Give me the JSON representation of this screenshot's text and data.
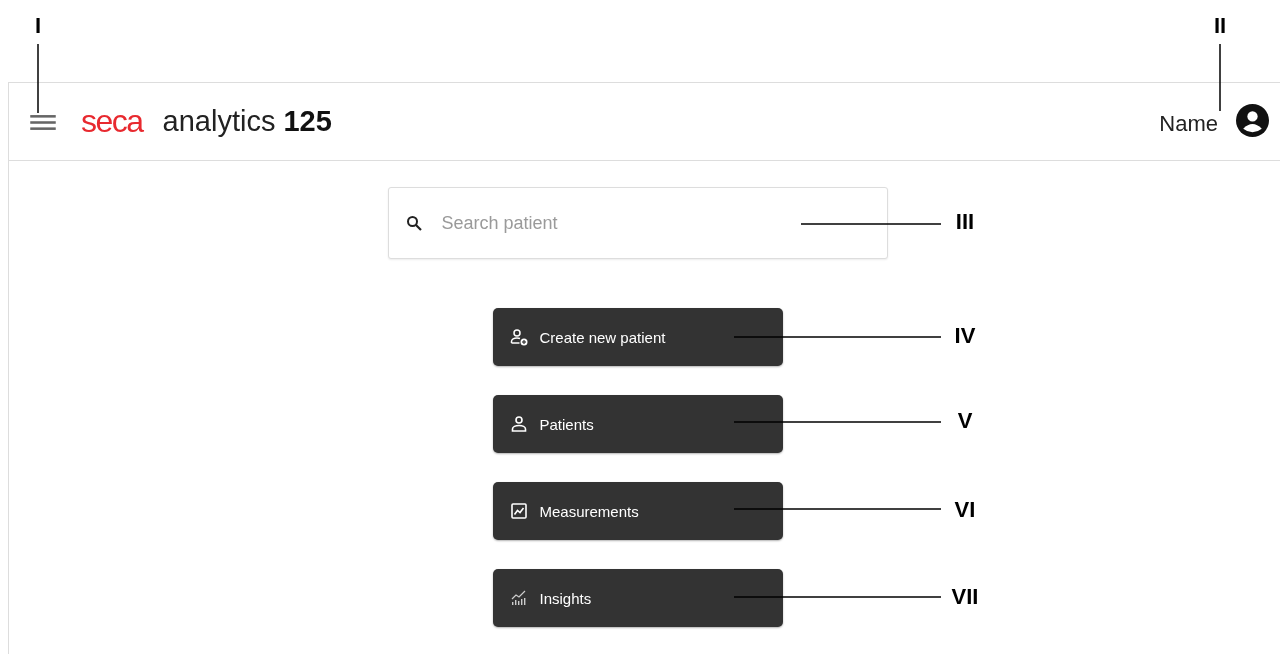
{
  "header": {
    "logo": "seca",
    "title": "analytics",
    "title_number": "125",
    "user_name": "Name"
  },
  "search": {
    "placeholder": "Search patient"
  },
  "actions": [
    {
      "label": "Create new patient",
      "kind": "person-add"
    },
    {
      "label": "Patients",
      "kind": "person"
    },
    {
      "label": "Measurements",
      "kind": "chart"
    },
    {
      "label": "Insights",
      "kind": "insights"
    }
  ],
  "callouts": [
    {
      "label": "I"
    },
    {
      "label": "II"
    },
    {
      "label": "III"
    },
    {
      "label": "IV"
    },
    {
      "label": "V"
    },
    {
      "label": "VI"
    },
    {
      "label": "VII"
    }
  ]
}
